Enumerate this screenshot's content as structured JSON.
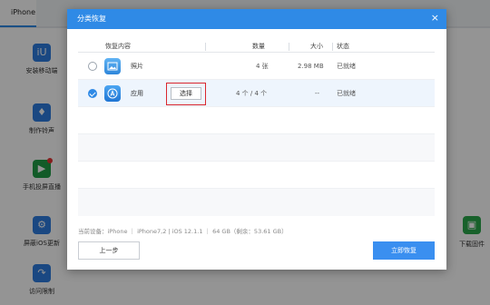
{
  "app": {
    "device_tab": "iPhone",
    "sidebar": [
      {
        "label": "安装移动端",
        "icon": "itools-app-icon"
      },
      {
        "label": "制作铃声",
        "icon": "bell-icon"
      },
      {
        "label": "手机投屏直播",
        "icon": "screen-mirror-icon"
      },
      {
        "label": "屏蔽iOS更新",
        "icon": "settings-gear-icon"
      },
      {
        "label": "访问限制",
        "icon": "restriction-icon"
      }
    ],
    "right_tool": {
      "label": "下载固件",
      "icon": "firmware-box-icon"
    }
  },
  "dialog": {
    "title": "分类恢复",
    "close_symbol": "×",
    "columns": {
      "content": "恢复内容",
      "count": "数量",
      "size": "大小",
      "status": "状态"
    },
    "rows": [
      {
        "name": "照片",
        "count": "4 张",
        "size": "2.98 MB",
        "status": "已就绪",
        "checked": false,
        "icon": "photos-icon"
      },
      {
        "name": "应用",
        "count": "4 个 / 4 个",
        "size": "--",
        "status": "已就绪",
        "checked": true,
        "icon": "app-store-icon",
        "select_label": "选择"
      }
    ],
    "device_info": "当前设备：iPhone ｜ iPhone7,2 | iOS 12.1.1 ｜ 64 GB（剩余：53.61 GB）",
    "prev_label": "上一步",
    "restore_label": "立即恢复"
  },
  "colors": {
    "accent": "#2f8ae6",
    "highlight": "#d9272e",
    "selected_row": "#eef5fd"
  }
}
